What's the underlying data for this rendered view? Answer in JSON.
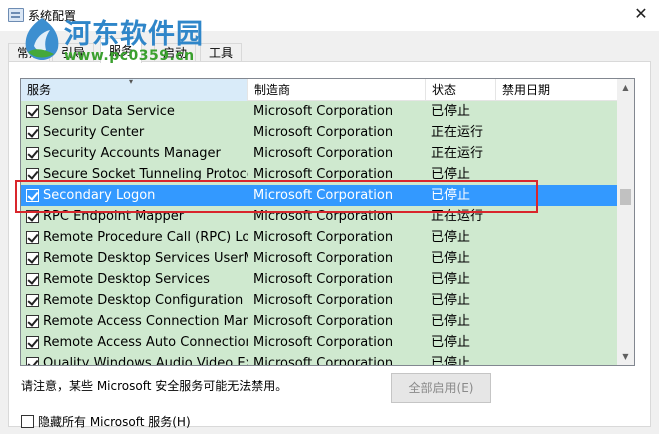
{
  "window": {
    "title": "系统配置",
    "close_glyph": "✕"
  },
  "watermark": {
    "title": "河东软件园",
    "url": "www.pc0359.cn"
  },
  "tabs": [
    {
      "label": "常规",
      "active": false
    },
    {
      "label": "引导",
      "active": false
    },
    {
      "label": "服务",
      "active": true
    },
    {
      "label": "启动",
      "active": false
    },
    {
      "label": "工具",
      "active": false
    }
  ],
  "list": {
    "columns": [
      "服务",
      "制造商",
      "状态",
      "禁用日期"
    ],
    "sorted_column": "服务",
    "rows": [
      {
        "checked": true,
        "name": "Sensor Data Service",
        "manufacturer": "Microsoft Corporation",
        "status": "已停止",
        "disabled_date": "",
        "selected": false
      },
      {
        "checked": true,
        "name": "Security Center",
        "manufacturer": "Microsoft Corporation",
        "status": "正在运行",
        "disabled_date": "",
        "selected": false
      },
      {
        "checked": true,
        "name": "Security Accounts Manager",
        "manufacturer": "Microsoft Corporation",
        "status": "正在运行",
        "disabled_date": "",
        "selected": false
      },
      {
        "checked": true,
        "name": "Secure Socket Tunneling Protoco...",
        "manufacturer": "Microsoft Corporation",
        "status": "已停止",
        "disabled_date": "",
        "selected": false
      },
      {
        "checked": true,
        "name": "Secondary Logon",
        "manufacturer": "Microsoft Corporation",
        "status": "已停止",
        "disabled_date": "",
        "selected": true
      },
      {
        "checked": true,
        "name": "RPC Endpoint Mapper",
        "manufacturer": "Microsoft Corporation",
        "status": "正在运行",
        "disabled_date": "",
        "selected": false
      },
      {
        "checked": true,
        "name": "Remote Procedure Call (RPC) Loc...",
        "manufacturer": "Microsoft Corporation",
        "status": "已停止",
        "disabled_date": "",
        "selected": false
      },
      {
        "checked": true,
        "name": "Remote Desktop Services UserM...",
        "manufacturer": "Microsoft Corporation",
        "status": "已停止",
        "disabled_date": "",
        "selected": false
      },
      {
        "checked": true,
        "name": "Remote Desktop Services",
        "manufacturer": "Microsoft Corporation",
        "status": "已停止",
        "disabled_date": "",
        "selected": false
      },
      {
        "checked": true,
        "name": "Remote Desktop Configuration",
        "manufacturer": "Microsoft Corporation",
        "status": "已停止",
        "disabled_date": "",
        "selected": false
      },
      {
        "checked": true,
        "name": "Remote Access Connection Man...",
        "manufacturer": "Microsoft Corporation",
        "status": "已停止",
        "disabled_date": "",
        "selected": false
      },
      {
        "checked": true,
        "name": "Remote Access Auto Connection ...",
        "manufacturer": "Microsoft Corporation",
        "status": "已停止",
        "disabled_date": "",
        "selected": false
      },
      {
        "checked": true,
        "name": "Quality Windows Audio Video Ex...",
        "manufacturer": "Microsoft Corporation",
        "status": "已停止",
        "disabled_date": "",
        "selected": false
      }
    ]
  },
  "footer": {
    "note": "请注意，某些 Microsoft 安全服务可能无法禁用。",
    "enable_all_label": "全部启用(E)",
    "hide_ms_label": "隐藏所有 Microsoft 服务(H)",
    "hide_ms_checked": false
  },
  "colors": {
    "row_background": "#cfe9cf",
    "selection": "#3399ff",
    "highlight_border": "#d9262c",
    "watermark_blue": "#2f86c9",
    "watermark_green": "#3aa02e"
  }
}
